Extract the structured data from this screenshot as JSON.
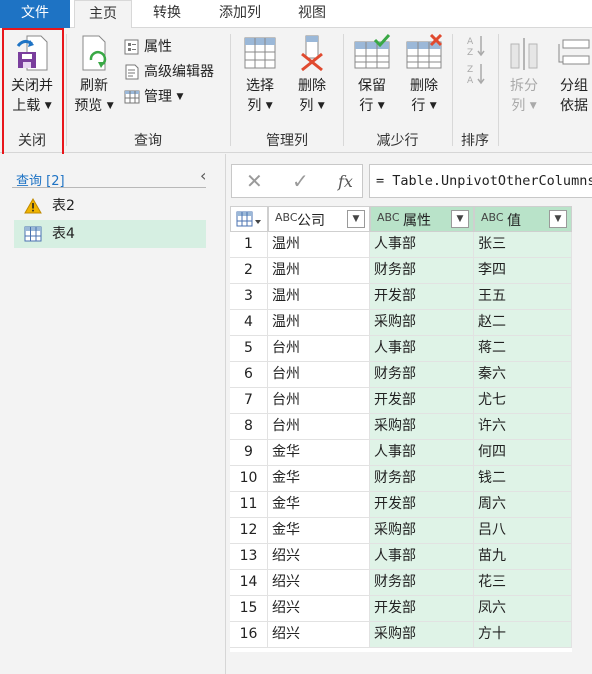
{
  "tabs": {
    "file": "文件",
    "home": "主页",
    "transform": "转换",
    "add_column": "添加列",
    "view": "视图"
  },
  "ribbon": {
    "close_load": {
      "line1": "关闭并",
      "line2": "上载",
      "group": "关闭"
    },
    "refresh": {
      "line1": "刷新",
      "line2": "预览"
    },
    "properties": "属性",
    "advanced_editor": "高级编辑器",
    "manage": "管理",
    "query_group": "查询",
    "choose_cols": {
      "line1": "选择",
      "line2": "列"
    },
    "remove_cols": {
      "line1": "删除",
      "line2": "列"
    },
    "manage_cols_group": "管理列",
    "keep_rows": {
      "line1": "保留",
      "line2": "行"
    },
    "remove_rows": {
      "line1": "删除",
      "line2": "行"
    },
    "reduce_rows_group": "减少行",
    "sort_group": "排序",
    "split_col": {
      "line1": "拆分",
      "line2": "列"
    },
    "group_by": {
      "line1": "分组",
      "line2": "依据"
    }
  },
  "queries": {
    "header": "查询 [2]",
    "items": [
      {
        "label": "表2"
      },
      {
        "label": "表4"
      }
    ]
  },
  "formula": {
    "text": "= Table.UnpivotOtherColumns"
  },
  "table": {
    "type_label": "ABC",
    "columns": [
      "公司",
      "属性",
      "值"
    ],
    "rows": [
      [
        "1",
        "温州",
        "人事部",
        "张三"
      ],
      [
        "2",
        "温州",
        "财务部",
        "李四"
      ],
      [
        "3",
        "温州",
        "开发部",
        "王五"
      ],
      [
        "4",
        "温州",
        "采购部",
        "赵二"
      ],
      [
        "5",
        "台州",
        "人事部",
        "蒋二"
      ],
      [
        "6",
        "台州",
        "财务部",
        "秦六"
      ],
      [
        "7",
        "台州",
        "开发部",
        "尤七"
      ],
      [
        "8",
        "台州",
        "采购部",
        "许六"
      ],
      [
        "9",
        "金华",
        "人事部",
        "何四"
      ],
      [
        "10",
        "金华",
        "财务部",
        "钱二"
      ],
      [
        "11",
        "金华",
        "开发部",
        "周六"
      ],
      [
        "12",
        "金华",
        "采购部",
        "吕八"
      ],
      [
        "13",
        "绍兴",
        "人事部",
        "苗九"
      ],
      [
        "14",
        "绍兴",
        "财务部",
        "花三"
      ],
      [
        "15",
        "绍兴",
        "开发部",
        "凤六"
      ],
      [
        "16",
        "绍兴",
        "采购部",
        "方十"
      ]
    ]
  }
}
